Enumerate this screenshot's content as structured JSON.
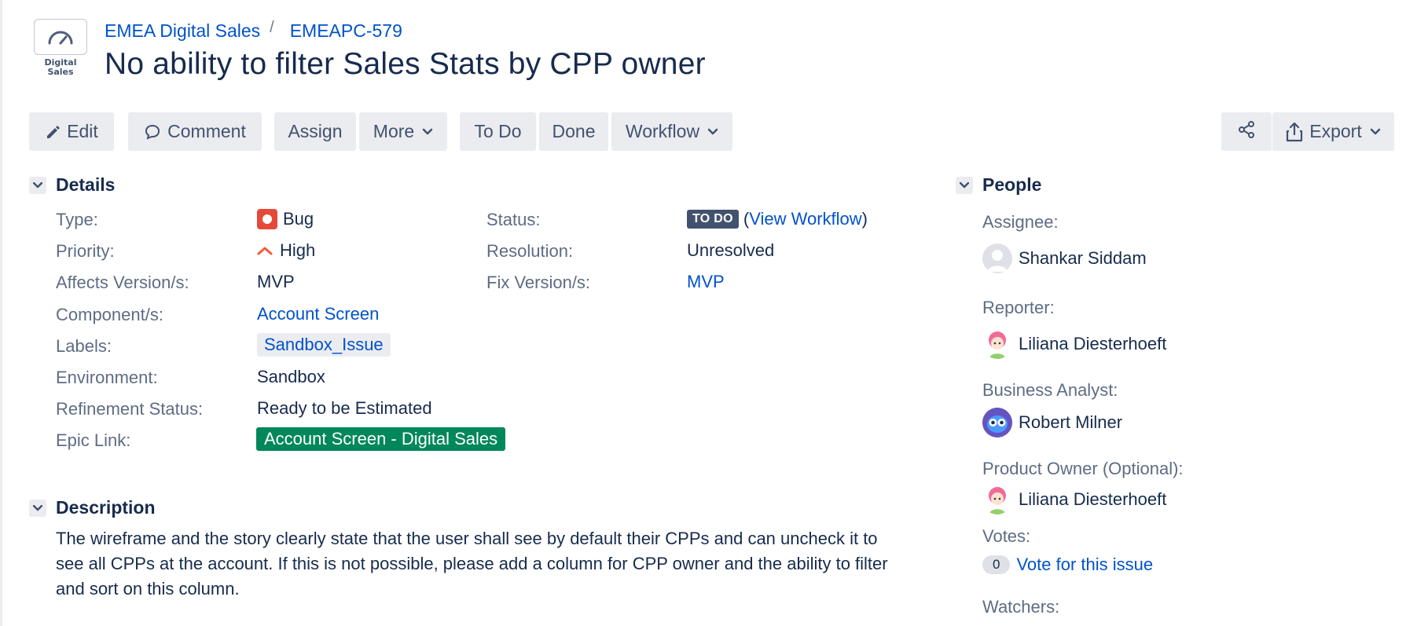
{
  "project": {
    "avatar_text_line1": "Digital",
    "avatar_text_line2": "Sales"
  },
  "breadcrumb": {
    "project_name": "EMEA Digital Sales",
    "separator": "/",
    "issue_key": "EMEAPC-579"
  },
  "issue": {
    "title": "No ability to filter Sales Stats by CPP owner"
  },
  "toolbar": {
    "edit_label": "Edit",
    "comment_label": "Comment",
    "assign_label": "Assign",
    "more_label": "More",
    "todo_label": "To Do",
    "done_label": "Done",
    "workflow_label": "Workflow",
    "export_label": "Export"
  },
  "details": {
    "section_title": "Details",
    "type_label": "Type:",
    "type_value": "Bug",
    "priority_label": "Priority:",
    "priority_value": "High",
    "affects_label": "Affects Version/s:",
    "affects_value": "MVP",
    "component_label": "Component/s:",
    "component_value": "Account Screen",
    "labels_label": "Labels:",
    "labels_value": "Sandbox_Issue",
    "environment_label": "Environment:",
    "environment_value": "Sandbox",
    "refinement_label": "Refinement Status:",
    "refinement_value": "Ready to be Estimated",
    "epic_label": "Epic Link:",
    "epic_value": "Account Screen - Digital Sales",
    "status_label": "Status:",
    "status_value": "TO DO",
    "view_workflow_open": "(",
    "view_workflow_label": "View Workflow",
    "view_workflow_close": ")",
    "resolution_label": "Resolution:",
    "resolution_value": "Unresolved",
    "fix_label": "Fix Version/s:",
    "fix_value": "MVP"
  },
  "description": {
    "section_title": "Description",
    "text": "The wireframe and the story clearly state that the user shall see by default their CPPs and can uncheck it to see all CPPs at the account. If this is not possible, please add a column for CPP owner and the ability to filter and sort on this column."
  },
  "people": {
    "section_title": "People",
    "assignee_label": "Assignee:",
    "assignee_name": "Shankar Siddam",
    "reporter_label": "Reporter:",
    "reporter_name": "Liliana Diesterhoeft",
    "ba_label": "Business Analyst:",
    "ba_name": "Robert Milner",
    "po_label": "Product Owner (Optional):",
    "po_name": "Liliana Diesterhoeft",
    "votes_label": "Votes:",
    "votes_count": "0",
    "vote_link": "Vote for this issue",
    "watchers_label": "Watchers:"
  },
  "colors": {
    "link": "#0052cc",
    "bug_icon": "#e5493a",
    "priority_high": "#f15c3c",
    "status_lozenge": "#42526e",
    "epic": "#00875a",
    "button_bg": "#ebecf0"
  }
}
